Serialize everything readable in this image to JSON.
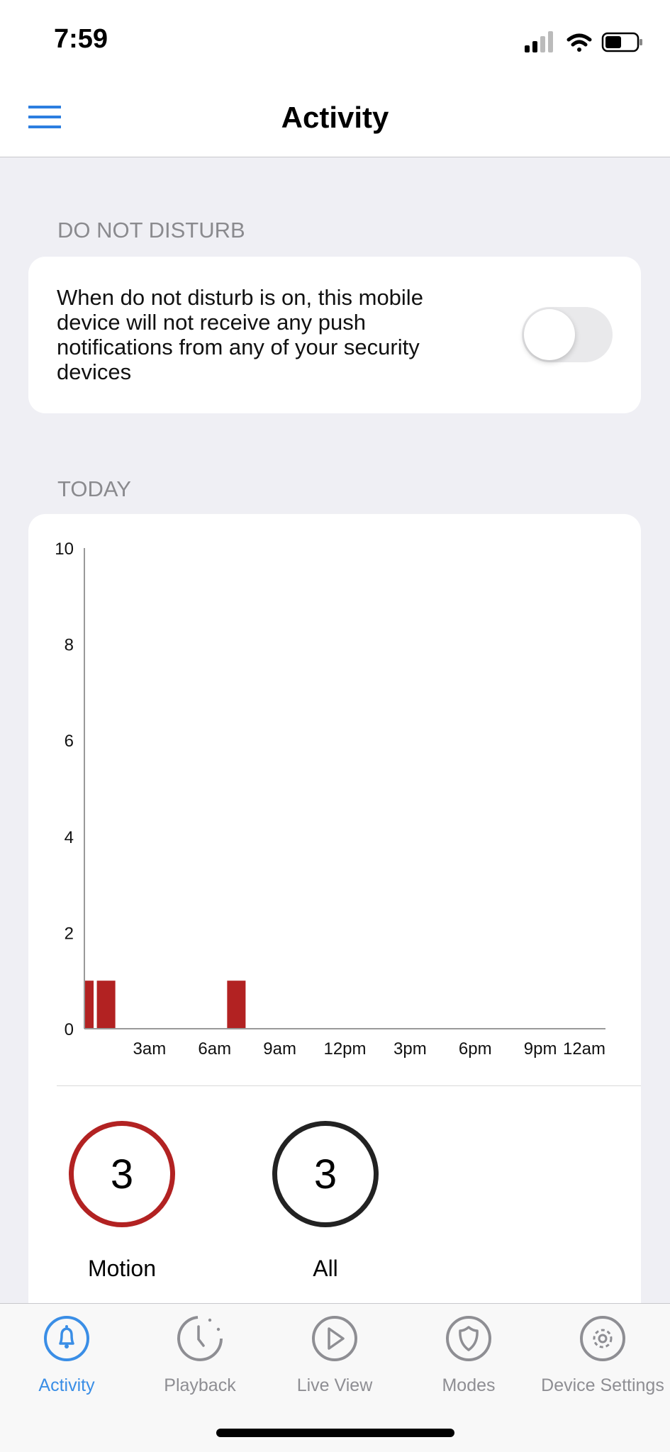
{
  "status_bar": {
    "time": "7:59",
    "battery_level": 0.5
  },
  "header": {
    "title": "Activity",
    "menu_icon": "hamburger-icon"
  },
  "dnd": {
    "section_label": "DO NOT DISTURB",
    "description": "When do not disturb is on, this mobile device will not receive any push notifications from any of your security devices",
    "enabled": false
  },
  "today": {
    "section_label": "TODAY"
  },
  "chart_data": {
    "type": "bar",
    "x_unit": "hour of day",
    "xlim": [
      0,
      24
    ],
    "ylim": [
      0,
      10
    ],
    "yticks": [
      "0",
      "2",
      "4",
      "6",
      "8",
      "10"
    ],
    "xticks": [
      {
        "hour": 3,
        "label": "3am"
      },
      {
        "hour": 6,
        "label": "6am"
      },
      {
        "hour": 9,
        "label": "9am"
      },
      {
        "hour": 12,
        "label": "12pm"
      },
      {
        "hour": 15,
        "label": "3pm"
      },
      {
        "hour": 18,
        "label": "6pm"
      },
      {
        "hour": 21,
        "label": "9pm"
      },
      {
        "hour": 24,
        "label": "12am"
      }
    ],
    "bars": [
      {
        "hour": 0,
        "value": 1
      },
      {
        "hour": 1,
        "value": 1
      },
      {
        "hour": 7,
        "value": 1
      }
    ],
    "color": "#b22222",
    "grid": false
  },
  "summary": [
    {
      "count": "3",
      "label": "Motion",
      "color": "#b22222"
    },
    {
      "count": "3",
      "label": "All",
      "color": "#222222"
    }
  ],
  "tabs": [
    {
      "label": "Activity",
      "icon": "bell-icon",
      "active": true
    },
    {
      "label": "Playback",
      "icon": "clock-icon"
    },
    {
      "label": "Live View",
      "icon": "play-icon"
    },
    {
      "label": "Modes",
      "icon": "shield-icon"
    },
    {
      "label": "Device Settings",
      "icon": "gear-icon"
    }
  ]
}
